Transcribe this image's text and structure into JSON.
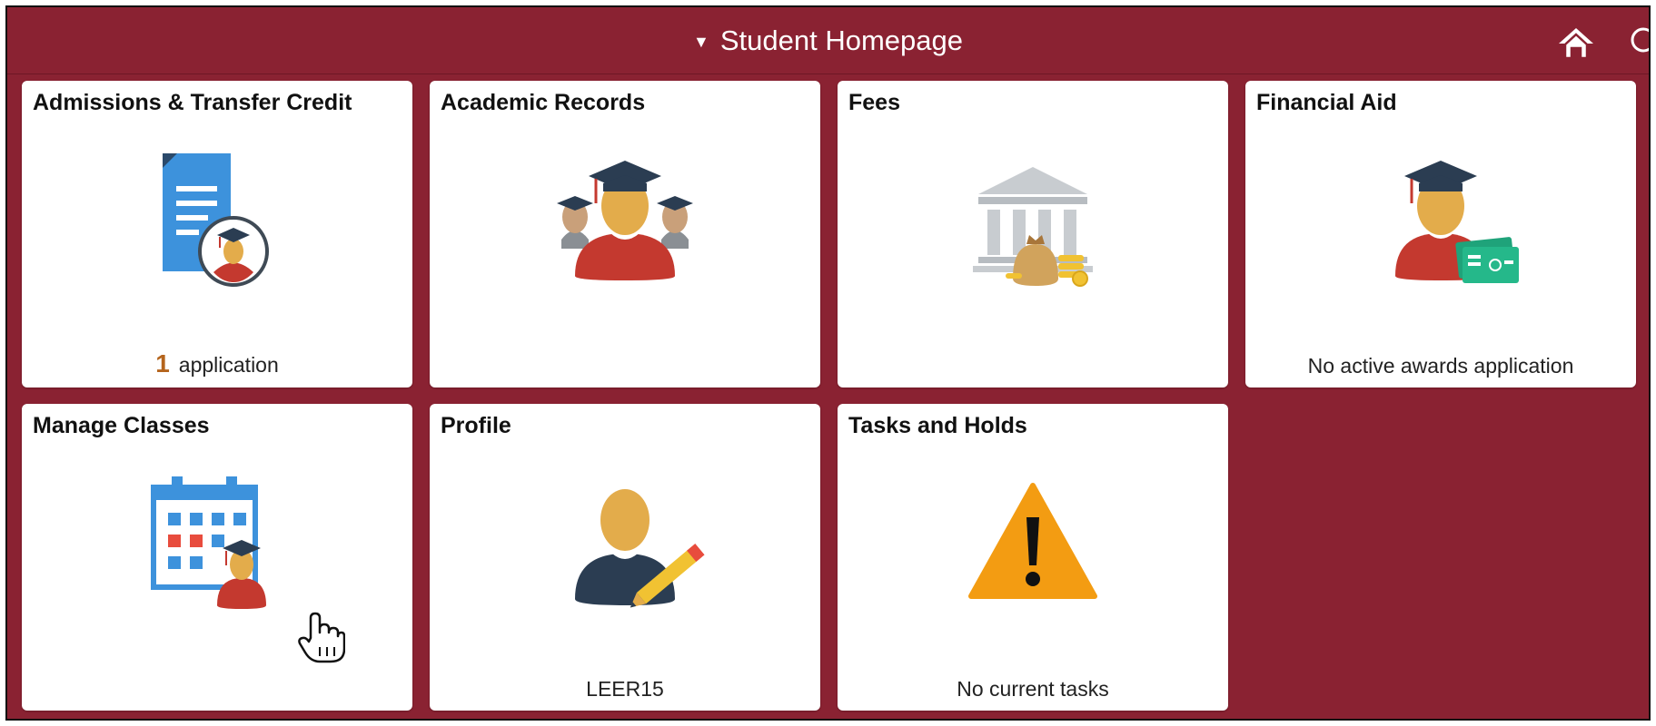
{
  "header": {
    "title": "Student Homepage",
    "caret": "▼",
    "home_icon": "home-icon",
    "search_icon": "search-icon"
  },
  "colors": {
    "brand": "#8a2232",
    "tile_bg": "#ffffff",
    "count_accent": "#b5651d"
  },
  "tiles": [
    {
      "title": "Admissions & Transfer Credit",
      "icon": "document-graduate-icon",
      "count": "1",
      "footer": "application"
    },
    {
      "title": "Academic Records",
      "icon": "students-group-icon",
      "footer": ""
    },
    {
      "title": "Fees",
      "icon": "bank-money-icon",
      "footer": ""
    },
    {
      "title": "Financial Aid",
      "icon": "graduate-card-icon",
      "footer": "No active awards application"
    },
    {
      "title": "Manage Classes",
      "icon": "calendar-graduate-icon",
      "footer": ""
    },
    {
      "title": "Profile",
      "icon": "person-pencil-icon",
      "footer": "LEER15"
    },
    {
      "title": "Tasks and Holds",
      "icon": "warning-icon",
      "footer": "No current tasks"
    }
  ]
}
